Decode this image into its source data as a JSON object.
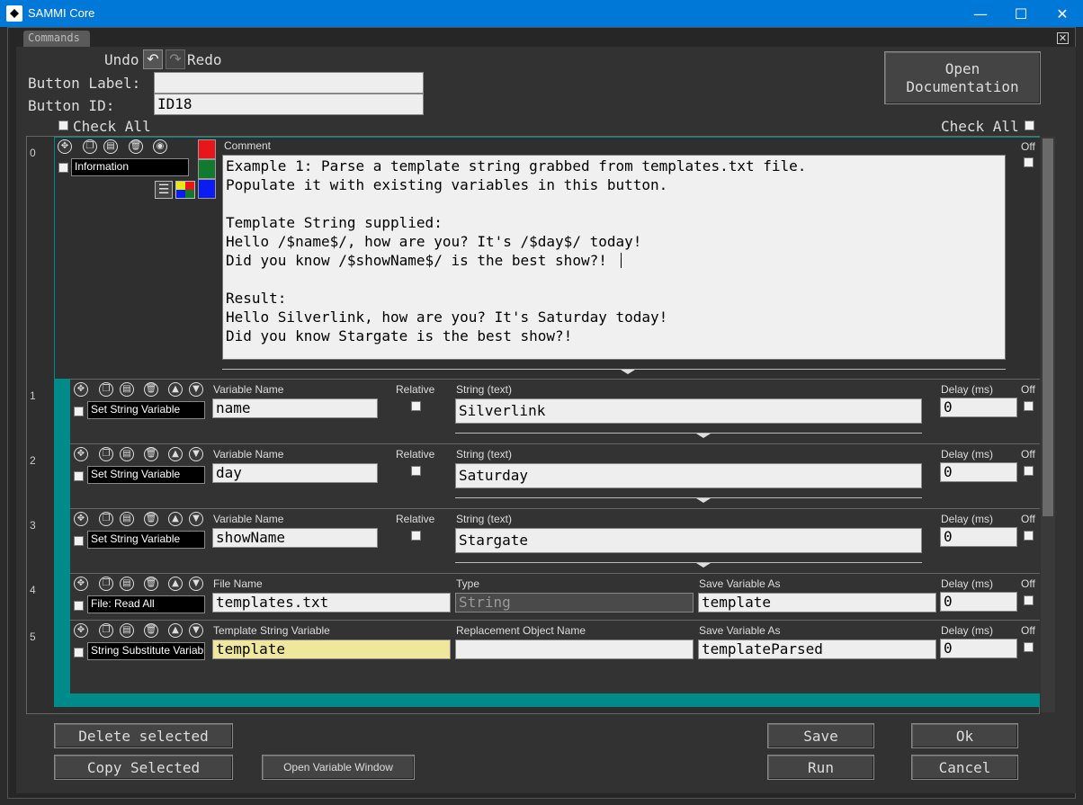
{
  "window": {
    "title": "SAMMI Core",
    "minimize": "—",
    "maximize": "☐",
    "close": "✕"
  },
  "tab": {
    "label": "Commands"
  },
  "toolbar": {
    "undo": "Undo",
    "redo": "Redo",
    "open_doc": "Open\nDocumentation"
  },
  "form": {
    "button_label": {
      "label": "Button Label:",
      "value": ""
    },
    "button_id": {
      "label": "Button ID:",
      "value": "ID18"
    },
    "check_all_left": "Check All",
    "check_all_right": "Check All"
  },
  "rows": [
    {
      "num": "0",
      "name": "Information",
      "field_label": "Comment",
      "off_label": "Off",
      "comment": "Example 1: Parse a template string grabbed from templates.txt file.\nPopulate it with existing variables in this button.\n\nTemplate String supplied:\nHello /$name$/, how are you? It's /$day$/ today!\nDid you know /$showName$/ is the best show?!\n\nResult:\nHello Silverlink, how are you? It's Saturday today!\nDid you know Stargate is the best show?!",
      "colors": [
        "#e8161b",
        "#117a2e",
        "#0a1cf0"
      ]
    },
    {
      "num": "1",
      "name": "Set String Variable",
      "l1": "Variable Name",
      "v1": "name",
      "l2": "Relative",
      "l3": "String (text)",
      "v3": "Silverlink",
      "l4": "Delay (ms)",
      "v4": "0",
      "off": "Off"
    },
    {
      "num": "2",
      "name": "Set String Variable",
      "l1": "Variable Name",
      "v1": "day",
      "l2": "Relative",
      "l3": "String (text)",
      "v3": "Saturday",
      "l4": "Delay (ms)",
      "v4": "0",
      "off": "Off"
    },
    {
      "num": "3",
      "name": "Set String Variable",
      "l1": "Variable Name",
      "v1": "showName",
      "l2": "Relative",
      "l3": "String (text)",
      "v3": "Stargate",
      "l4": "Delay (ms)",
      "v4": "0",
      "off": "Off"
    },
    {
      "num": "4",
      "name": "File: Read All",
      "l1": "File Name",
      "v1": "templates.txt",
      "l2": "Type",
      "v2": "String",
      "l3": "Save Variable As",
      "v3": "template",
      "l4": "Delay (ms)",
      "v4": "0",
      "off": "Off"
    },
    {
      "num": "5",
      "name": "String Substitute Variables",
      "l1": "Template String Variable",
      "v1": "template",
      "l2": "Replacement Object Name",
      "v2": "",
      "l3": "Save Variable As",
      "v3": "templateParsed",
      "l4": "Delay (ms)",
      "v4": "0",
      "off": "Off"
    }
  ],
  "footer": {
    "delete_selected": "Delete selected",
    "copy_selected": "Copy Selected",
    "open_var_window": "Open Variable Window",
    "save": "Save",
    "run": "Run",
    "ok": "Ok",
    "cancel": "Cancel"
  }
}
